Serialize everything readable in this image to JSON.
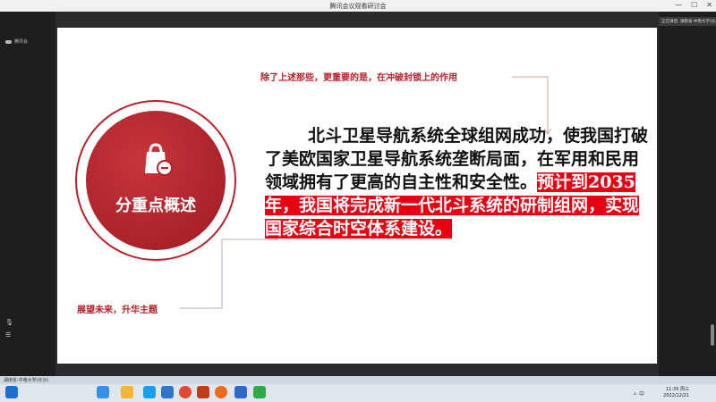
{
  "window": {
    "title": "腾讯会议观看研讨会",
    "min": "—",
    "max": "☐",
    "close": "✕"
  },
  "left_panel": {
    "user_label": "腾讯会",
    "mic_icon": "microphone-icon",
    "list_icon": "list-icon"
  },
  "right_panel": {
    "speaking": "正在讲话: 湖南省·中南大学(长沙)"
  },
  "slide": {
    "circle_title": "分重点概述",
    "icon": "shopping-bag-icon",
    "annotation_top": "除了上述那些，更重要的是，在冲破封锁上的作用",
    "annotation_bottom": "展望未来，升华主题",
    "text_normal": "北斗卫星导航系统全球组网成功，使我国打破了美欧国家卫星导航系统垄断局面，在军用和民用领域拥有了更高的自主性和安全性。",
    "text_highlight": "预计到2035年，我国将完成新一代北斗系统的研制组网，实现国家综合时空体系建设。"
  },
  "taskbar": {
    "notice": "湖南省·中南大学(长沙)",
    "time": "11:35 周三",
    "date": "2022/12/21",
    "tray_text": "ㅅ 中"
  },
  "colors": {
    "accent": "#b5222a",
    "highlight": "#e60012"
  }
}
